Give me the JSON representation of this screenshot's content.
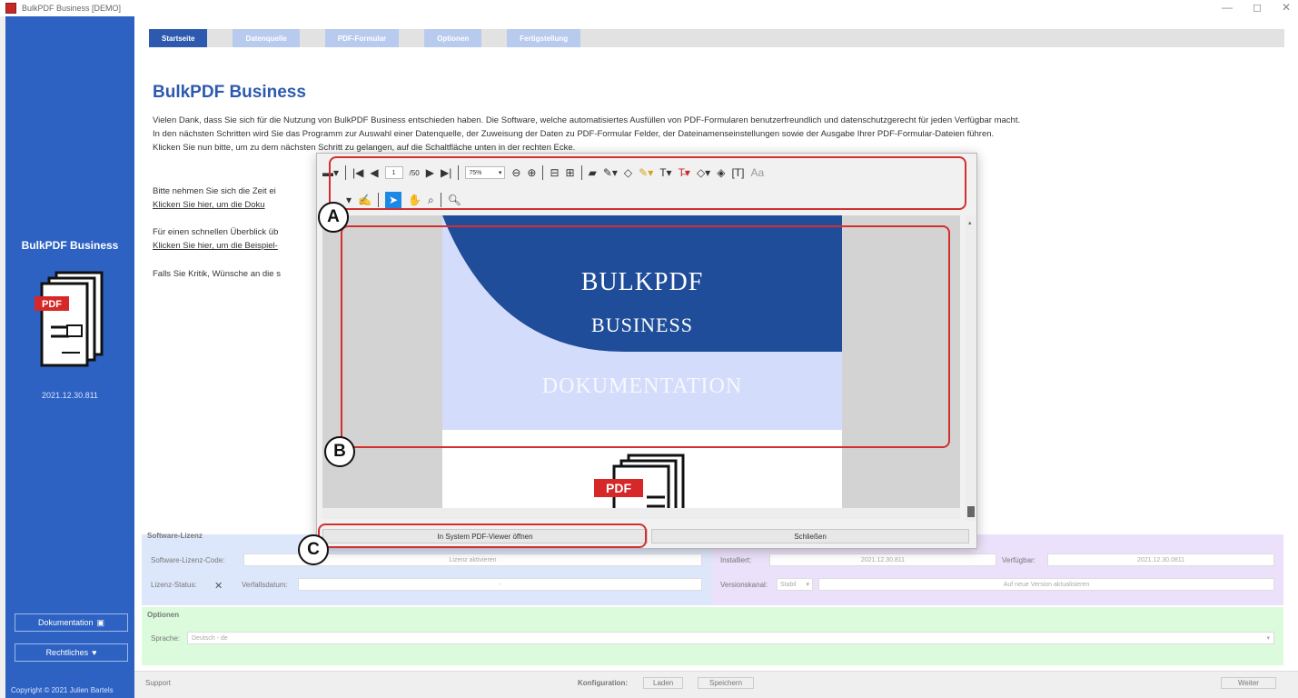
{
  "window": {
    "title": "BulkPDF Business [DEMO]",
    "controls": [
      "—",
      "◻",
      "✕"
    ]
  },
  "sidebar": {
    "brand": "BulkPDF Business",
    "pdf_badge": "PDF",
    "version": "2021.12.30.811",
    "documentation_label": "Dokumentation",
    "legal_label": "Rechtliches",
    "copyright": "Copyright © 2021 Julien Bartels"
  },
  "steps": [
    "Startseite",
    "Datenquelle",
    "PDF-Formular",
    "Optionen",
    "Fertigstellung"
  ],
  "main": {
    "heading": "BulkPDF Business",
    "intro_1": "Vielen Dank, dass Sie sich für die Nutzung von BulkPDF Business entschieden haben. Die Software, welche automatisiertes Ausfüllen von PDF-Formularen benutzerfreundlich und datenschutzgerecht für jeden Verfügbar macht.",
    "intro_2": "In den nächsten Schritten wird Sie das Programm zur Auswahl einer Datenquelle, der Zuweisung der Daten zu PDF-Formular Felder, der Dateinamenseinstellungen sowie der Ausgabe Ihrer PDF-Formular-Dateien führen.",
    "intro_3": "Klicken Sie nun bitte, um zu dem nächsten Schritt zu gelangen, auf die Schaltfläche unten in der rechten Ecke.",
    "para_1a": "Bitte nehmen Sie sich die Zeit ei",
    "para_1b": "Klicken Sie hier, um die Doku",
    "para_2a": "Für einen schnellen Überblick üb",
    "para_2b": "Klicken Sie hier, um die Beispiel-",
    "para_3": "Falls Sie Kritik, Wünsche an die s"
  },
  "license": {
    "section": "Software-Lizenz",
    "code_label": "Software-Lizenz-Code:",
    "activate": "Lizenz aktivieren",
    "status_label": "Lizenz-Status:",
    "status_value": "✕",
    "expiry_label": "Verfallsdatum:",
    "expiry_value": "-",
    "installed_label": "Installiert:",
    "installed_value": "2021.12.30.811",
    "available_label": "Verfügbar:",
    "available_value": "2021.12.30.0811",
    "channel_label": "Versionskanal:",
    "channel_value": "Stabil",
    "update_button": "Auf neue Version aktualisieren"
  },
  "options": {
    "section": "Optionen",
    "language_label": "Sprache:",
    "language_value": "Deutsch - de"
  },
  "bottombar": {
    "support": "Support",
    "config_label": "Konfiguration:",
    "load": "Laden",
    "save": "Speichern",
    "next": "Weiter"
  },
  "dialog": {
    "page_current": "1",
    "page_total": "/50",
    "zoom": "75%",
    "doc_line1": "BULKPDF",
    "doc_line2": "BUSINESS",
    "doc_line3": "DOKUMENTATION",
    "doc_pdf_badge": "PDF",
    "open_system_viewer": "In System PDF-Viewer öffnen",
    "close": "Schließen"
  },
  "callouts": [
    "A",
    "B",
    "C"
  ],
  "colors": {
    "sidebar_blue": "#2e62c2",
    "accent_blue": "#2d5aae",
    "callout_red": "#d32f2f",
    "license_blue": "#dde7fb",
    "license_purple": "#ebe1fb",
    "options_green": "#dcfadc"
  }
}
